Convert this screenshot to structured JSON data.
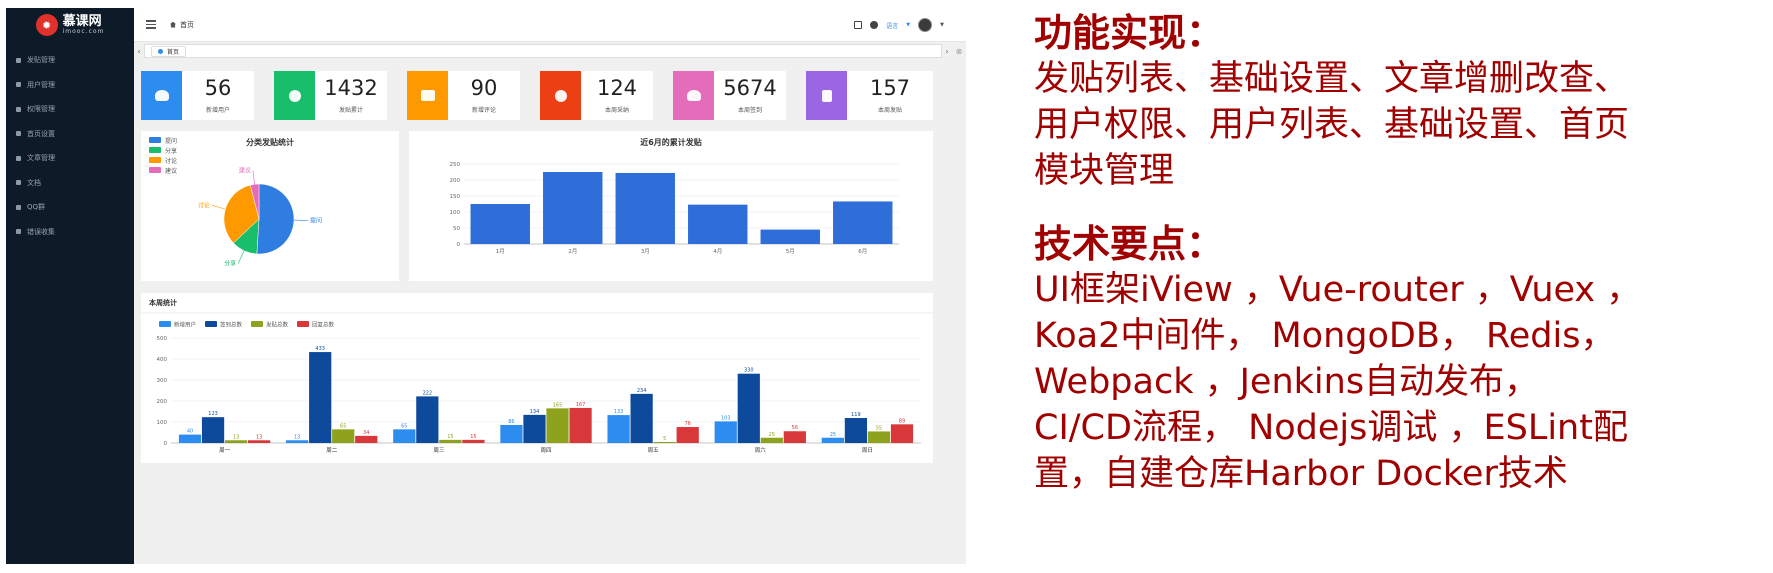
{
  "sidebar": {
    "logo_text": "慕课网",
    "logo_sub": "imooc.com",
    "items": [
      {
        "label": "发贴管理"
      },
      {
        "label": "用户管理"
      },
      {
        "label": "权限管理"
      },
      {
        "label": "首页设置"
      },
      {
        "label": "文章管理"
      },
      {
        "label": "文档"
      },
      {
        "label": "QQ群"
      },
      {
        "label": "错误收集"
      }
    ]
  },
  "header": {
    "breadcrumb": "首页",
    "language": "语言"
  },
  "tabs": [
    {
      "label": "首页"
    }
  ],
  "stats": [
    {
      "value": "56",
      "label": "新增用户",
      "color": "#2d8cf0",
      "icon": "user-add-icon"
    },
    {
      "value": "1432",
      "label": "发贴累计",
      "color": "#19be6b",
      "icon": "target-icon"
    },
    {
      "value": "90",
      "label": "新增评论",
      "color": "#ff9900",
      "icon": "comment-icon"
    },
    {
      "value": "124",
      "label": "本周采纳",
      "color": "#ed3f14",
      "icon": "check-icon"
    },
    {
      "value": "5674",
      "label": "本周签到",
      "color": "#E46CBB",
      "icon": "users-icon"
    },
    {
      "value": "157",
      "label": "本周发贴",
      "color": "#9A66E4",
      "icon": "map-icon"
    }
  ],
  "chart_data": [
    {
      "type": "pie",
      "title": "分类发贴统计",
      "legend": [
        "提问",
        "分享",
        "讨论",
        "建议"
      ],
      "legend_position": "top-left",
      "labels": [
        "提问",
        "分享",
        "讨论",
        "建议"
      ],
      "values": [
        51,
        12,
        33,
        4
      ],
      "colors": [
        "#2f7de1",
        "#19be6b",
        "#ff9900",
        "#e46cbb"
      ]
    },
    {
      "type": "bar",
      "title": "近6月的累计发贴",
      "categories": [
        "1月",
        "2月",
        "3月",
        "4月",
        "5月",
        "6月"
      ],
      "values": [
        125,
        225,
        222,
        123,
        45,
        133
      ],
      "ylim": [
        0,
        250
      ],
      "yticks": [
        0,
        50,
        100,
        150,
        200,
        250
      ],
      "color": "#2f6ed9"
    },
    {
      "type": "bar",
      "title": "本周统计",
      "legend_position": "top-left",
      "categories": [
        "周一",
        "周二",
        "周三",
        "周四",
        "周五",
        "周六",
        "周日"
      ],
      "series": [
        {
          "name": "新增用户",
          "color": "#2d8cf0",
          "values": [
            40,
            13,
            65,
            86,
            133,
            103,
            25
          ]
        },
        {
          "name": "签到总数",
          "color": "#0d4a9c",
          "values": [
            123,
            433,
            222,
            134,
            234,
            330,
            119
          ]
        },
        {
          "name": "发贴总数",
          "color": "#8ea21d",
          "values": [
            13,
            65,
            15,
            165,
            5,
            25,
            55
          ]
        },
        {
          "name": "回复总数",
          "color": "#d9383a",
          "values": [
            13,
            34,
            15,
            167,
            76,
            56,
            89
          ]
        }
      ],
      "ylim": [
        0,
        500
      ],
      "yticks": [
        0,
        100,
        200,
        300,
        400,
        500
      ]
    }
  ],
  "notes": {
    "features_heading": "功能实现：",
    "features_lines": [
      "发贴列表、基础设置、文章增删改查、",
      "用户权限、用户列表、基础设置、首页",
      "模块管理"
    ],
    "tech_heading": "技术要点：",
    "tech_lines": [
      "UI框架iView ，Vue-router ，Vuex ，",
      "Koa2中间件， MongoDB， Redis，",
      "Webpack ，Jenkins自动发布，",
      "CI/CD流程， Nodejs调试 ，ESLint配",
      "置，自建仓库Harbor Docker技术"
    ]
  }
}
